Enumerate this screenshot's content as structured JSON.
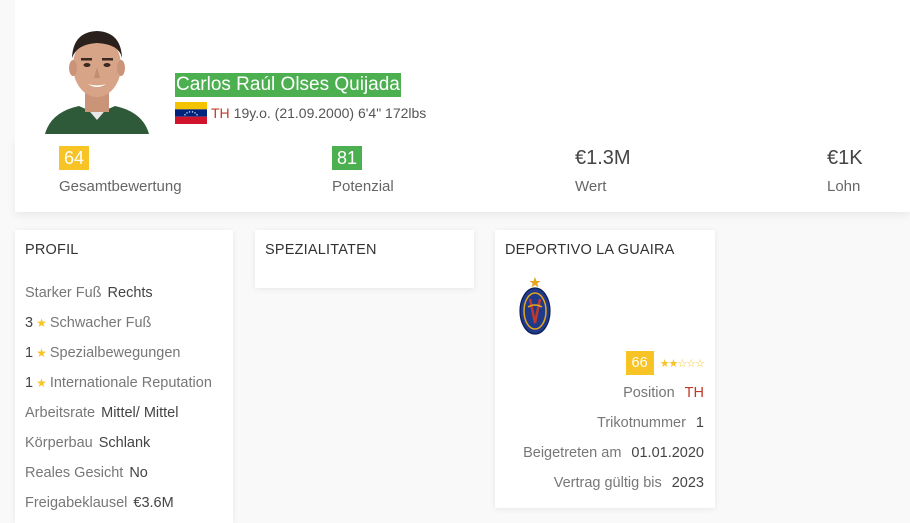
{
  "player": {
    "name": "Carlos Raúl Olses Quijada",
    "position": "TH",
    "info": "19y.o. (21.09.2000) 6'4\" 172lbs",
    "flag": "venezuela-flag"
  },
  "stats": [
    {
      "value": "64",
      "label": "Gesamtbewertung",
      "badge_color": "#f7c325"
    },
    {
      "value": "81",
      "label": "Potenzial",
      "badge_color": "#4caf50"
    },
    {
      "value": "€1.3M",
      "label": "Wert"
    },
    {
      "value": "€1K",
      "label": "Lohn"
    }
  ],
  "profile": {
    "title": "PROFIL",
    "strong_foot_label": "Starker Fuß",
    "strong_foot_value": "Rechts",
    "weak_foot_num": "3",
    "weak_foot_label": "Schwacher Fuß",
    "skill_moves_num": "1",
    "skill_moves_label": "Spezialbewegungen",
    "intl_rep_num": "1",
    "intl_rep_label": "Internationale Reputation",
    "work_rate_label": "Arbeitsrate",
    "work_rate_value": "Mittel/ Mittel",
    "body_label": "Körperbau",
    "body_value": "Schlank",
    "real_face_label": "Reales Gesicht",
    "real_face_value": "No",
    "release_label": "Freigabeklausel",
    "release_value": "€3.6M"
  },
  "specialities": {
    "title": "SPEZIALITATEN"
  },
  "club": {
    "title": "DEPORTIVO LA GUAIRA",
    "rating": "66",
    "star_rating": "2 of 5",
    "position_label": "Position",
    "position_value": "TH",
    "jersey_label": "Trikotnummer",
    "jersey_value": "1",
    "joined_label": "Beigetreten am",
    "joined_value": "01.01.2020",
    "contract_label": "Vertrag gültig bis",
    "contract_value": "2023"
  }
}
